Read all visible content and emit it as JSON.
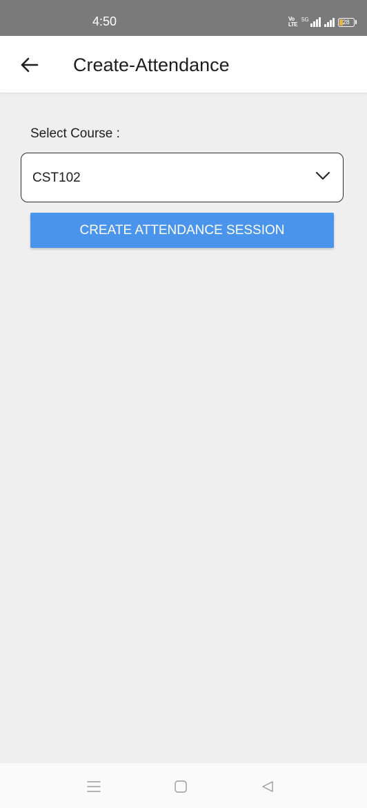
{
  "status_bar": {
    "time": "4:50",
    "network_label": "Vo LTE",
    "signal_label": "5G",
    "battery": "28",
    "battery_level": 0.28
  },
  "app_bar": {
    "title": "Create-Attendance",
    "back_icon": "arrow-left-icon"
  },
  "form": {
    "select_label": "Select Course :",
    "selected_course": "CST102",
    "dropdown_icon": "chevron-down-icon",
    "create_button_label": "CREATE ATTENDANCE SESSION"
  },
  "colors": {
    "status_bar_bg": "#7a7a7a",
    "page_bg": "#efeff0",
    "button_bg": "#4b94ec",
    "battery_accent": "#e7b649"
  },
  "nav_bar": {
    "items": [
      "menu-icon",
      "home-square-icon",
      "back-triangle-icon"
    ]
  }
}
